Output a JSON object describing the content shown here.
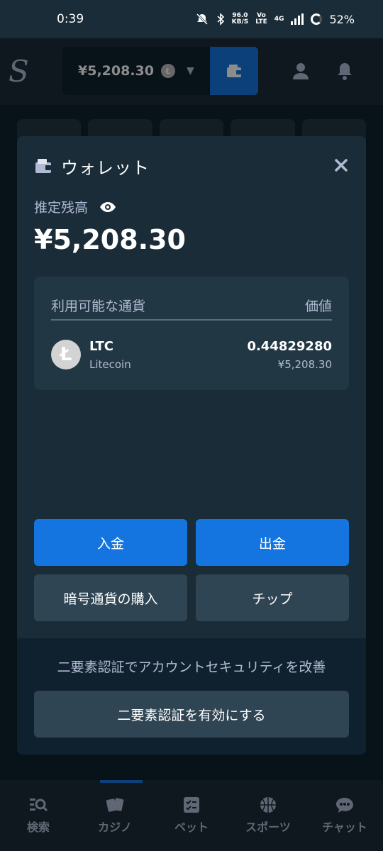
{
  "status_bar": {
    "time": "0:39",
    "net_speed_value": "96.0",
    "net_speed_unit": "KB/S",
    "volte_top": "Vo",
    "volte_bottom": "LTE",
    "network": "4G",
    "battery": "52%"
  },
  "app_header": {
    "logo": "S",
    "balance": "¥5,208.30",
    "currency_icon_letter": "Ł"
  },
  "wallet_modal": {
    "title": "ウォレット",
    "estimated_balance_label": "推定残高",
    "estimated_balance": "¥5,208.30",
    "currency_table": {
      "header_currency": "利用可能な通貨",
      "header_value": "価値",
      "rows": [
        {
          "icon_letter": "Ł",
          "symbol": "LTC",
          "name": "Litecoin",
          "amount": "0.44829280",
          "fiat": "¥5,208.30"
        }
      ]
    },
    "buttons": {
      "deposit": "入金",
      "withdraw": "出金",
      "buy_crypto": "暗号通貨の購入",
      "tip": "チップ"
    },
    "security": {
      "message": "二要素認証でアカウントセキュリティを改善",
      "enable_2fa": "二要素認証を有効にする"
    }
  },
  "bottom_nav": {
    "items": [
      {
        "label": "検索",
        "icon": "search-list-icon"
      },
      {
        "label": "カジノ",
        "icon": "cards-icon"
      },
      {
        "label": "ベット",
        "icon": "checklist-icon"
      },
      {
        "label": "スポーツ",
        "icon": "basketball-icon"
      },
      {
        "label": "チャット",
        "icon": "chat-bubble-icon"
      }
    ]
  },
  "colors": {
    "background": "#0f212e",
    "surface": "#1a2c38",
    "panel": "#213743",
    "primary": "#1475e1",
    "secondary_button": "#2f4553",
    "muted_text": "#b1bad3"
  }
}
